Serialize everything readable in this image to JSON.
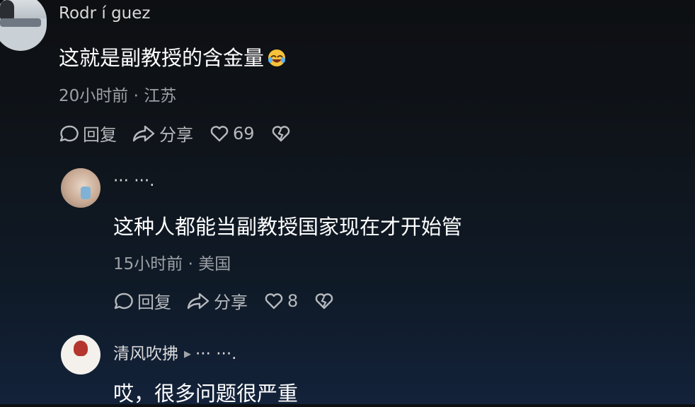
{
  "comments": [
    {
      "username": "Rodr í guez",
      "text": "这就是副教授的含金量",
      "emoji_icon": "laughing-crying-emoji",
      "time": "20小时前",
      "location": "江苏",
      "reply_label": "回复",
      "share_label": "分享",
      "likes": "69"
    },
    {
      "username": "··· ···.",
      "text": "这种人都能当副教授国家现在才开始管",
      "time": "15小时前",
      "location": "美国",
      "reply_label": "回复",
      "share_label": "分享",
      "likes": "8"
    },
    {
      "username": "清风吹拂",
      "reply_to": "··· ···.",
      "text": "哎，很多问题很严重"
    }
  ],
  "separator": "·",
  "colors": {
    "background_top": "#0d0f12",
    "background_bottom": "#13223a",
    "text_primary": "#ffffff",
    "text_secondary": "#9da1a6",
    "action_gray": "#b6b9bd"
  }
}
